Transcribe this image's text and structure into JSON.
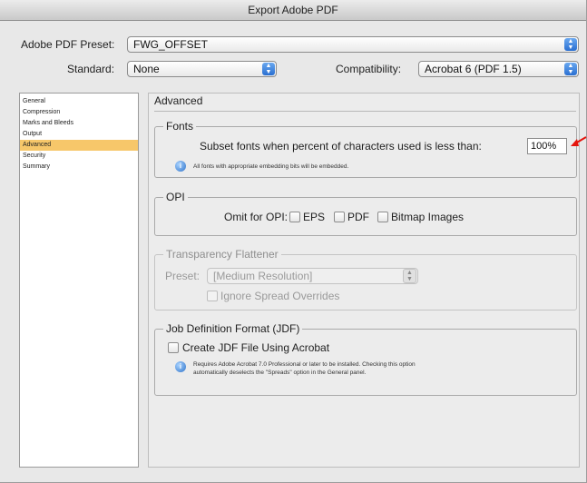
{
  "window": {
    "title": "Export Adobe PDF"
  },
  "header": {
    "preset_label": "Adobe PDF Preset:",
    "preset_value": "FWG_OFFSET",
    "standard_label": "Standard:",
    "standard_value": "None",
    "compatibility_label": "Compatibility:",
    "compatibility_value": "Acrobat 6 (PDF 1.5)"
  },
  "sidebar": {
    "items": [
      {
        "label": "General"
      },
      {
        "label": "Compression"
      },
      {
        "label": "Marks and Bleeds"
      },
      {
        "label": "Output"
      },
      {
        "label": "Advanced",
        "selected": true
      },
      {
        "label": "Security"
      },
      {
        "label": "Summary"
      }
    ]
  },
  "panel": {
    "title": "Advanced",
    "fonts": {
      "legend": "Fonts",
      "subset_label": "Subset fonts when percent of characters used is less than:",
      "subset_value": "100%",
      "info_text": "All fonts with appropriate embedding bits will be embedded."
    },
    "opi": {
      "legend": "OPI",
      "omit_label": "Omit for OPI:",
      "eps_label": "EPS",
      "pdf_label": "PDF",
      "bitmap_label": "Bitmap Images"
    },
    "transparency": {
      "legend": "Transparency Flattener",
      "preset_label": "Preset:",
      "preset_value": "[Medium Resolution]",
      "ignore_label": "Ignore Spread Overrides"
    },
    "jdf": {
      "legend": "Job Definition Format (JDF)",
      "create_label": "Create JDF File Using Acrobat",
      "info_line1": "Requires Adobe Acrobat 7.0 Professional or later to be installed. Checking this option",
      "info_line2": "automatically deselects the \"Spreads\" option in the General panel."
    }
  },
  "colors": {
    "selection": "#f7c76a",
    "accent_arrow": "#e4140c",
    "popup_arrows": "#2a6fd1"
  }
}
